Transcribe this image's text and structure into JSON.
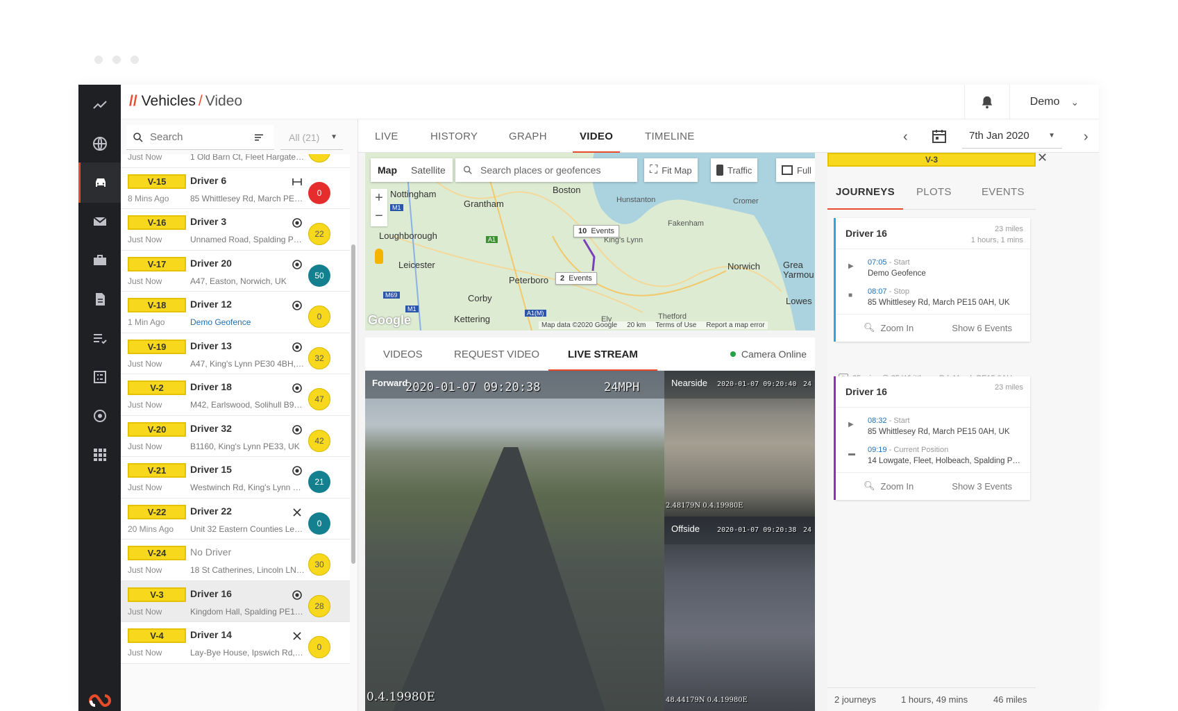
{
  "header": {
    "breadcrumb_root": "Vehicles",
    "breadcrumb_current": "Video",
    "user": "Demo"
  },
  "vehicle_list": {
    "search_placeholder": "Search",
    "filter_label": "All (21)",
    "rows": [
      {
        "tag": "",
        "driver": "",
        "time": "Just Now",
        "address": "1 Old Barn Ct, Fleet Hargate, H...",
        "status": "",
        "badge": "",
        "badge_color": "yellow"
      },
      {
        "tag": "V-15",
        "driver": "Driver 6",
        "time": "8 Mins Ago",
        "address": "85 Whittlesey Rd, March PE15 ...",
        "status": "parked",
        "badge": "0",
        "badge_color": "red"
      },
      {
        "tag": "V-16",
        "driver": "Driver 3",
        "time": "Just Now",
        "address": "Unnamed Road, Spalding PE1...",
        "status": "moving",
        "badge": "22",
        "badge_color": "yellow"
      },
      {
        "tag": "V-17",
        "driver": "Driver 20",
        "time": "Just Now",
        "address": "A47, Easton, Norwich, UK",
        "status": "moving",
        "badge": "50",
        "badge_color": "teal"
      },
      {
        "tag": "V-18",
        "driver": "Driver 12",
        "time": "1 Min Ago",
        "address": "Demo Geofence",
        "status": "moving",
        "badge": "0",
        "badge_color": "yellow",
        "link": true
      },
      {
        "tag": "V-19",
        "driver": "Driver 13",
        "time": "Just Now",
        "address": "A47, King's Lynn PE30 4BH, UK",
        "status": "moving",
        "badge": "32",
        "badge_color": "yellow"
      },
      {
        "tag": "V-2",
        "driver": "Driver 18",
        "time": "Just Now",
        "address": "M42, Earlswood, Solihull B94 5...",
        "status": "moving",
        "badge": "47",
        "badge_color": "yellow"
      },
      {
        "tag": "V-20",
        "driver": "Driver 32",
        "time": "Just Now",
        "address": "B1160, King's Lynn PE33, UK",
        "status": "moving",
        "badge": "42",
        "badge_color": "yellow"
      },
      {
        "tag": "V-21",
        "driver": "Driver 15",
        "time": "Just Now",
        "address": "Westwinch Rd, King's Lynn PE...",
        "status": "moving",
        "badge": "21",
        "badge_color": "teal"
      },
      {
        "tag": "V-22",
        "driver": "Driver 22",
        "time": "20 Mins Ago",
        "address": "Unit 32 Eastern Counties Leat...",
        "status": "off",
        "badge": "0",
        "badge_color": "teal"
      },
      {
        "tag": "V-24",
        "driver": "No Driver",
        "time": "Just Now",
        "address": "18 St Catherines, Lincoln LN5 ...",
        "status": "",
        "badge": "30",
        "badge_color": "yellow",
        "nodriver": true
      },
      {
        "tag": "V-3",
        "driver": "Driver 16",
        "time": "Just Now",
        "address": "Kingdom Hall, Spalding PE12 ...",
        "status": "moving",
        "badge": "28",
        "badge_color": "yellow",
        "selected": true
      },
      {
        "tag": "V-4",
        "driver": "Driver 14",
        "time": "Just Now",
        "address": "Lay-Bye House, Ipswich Rd, Sa...",
        "status": "off",
        "badge": "0",
        "badge_color": "yellow"
      }
    ]
  },
  "tabs": [
    "LIVE",
    "HISTORY",
    "GRAPH",
    "VIDEO",
    "TIMELINE"
  ],
  "active_tab": "VIDEO",
  "date": "7th Jan 2020",
  "map": {
    "type_map": "Map",
    "type_satellite": "Satellite",
    "search_placeholder": "Search places or geofences",
    "fit_map": "Fit Map",
    "traffic": "Traffic",
    "full": "Full",
    "cities": {
      "nottingham": "Nottingham",
      "grantham": "Grantham",
      "boston": "Boston",
      "hunstanton": "Hunstanton",
      "cromer": "Cromer",
      "fakenham": "Fakenham",
      "kings_lynn": "King's Lynn",
      "loughborough": "Loughborough",
      "leicester": "Leicester",
      "norwich": "Norwich",
      "great_yarmouth_1": "Grea",
      "great_yarmouth_2": "Yarmou",
      "peterborough": "Peterboro",
      "corby": "Corby",
      "lowestoft": "Lowes",
      "kettering": "Kettering",
      "thetford": "Thetford",
      "ely": "Ely"
    },
    "roads": {
      "m1": "M1",
      "a1": "A1",
      "m69": "M69",
      "m1b": "M1",
      "a1m": "A1(M)"
    },
    "events_1_count": "10",
    "events_1_label": "Events",
    "events_2_count": "2",
    "events_2_label": "Events",
    "footer_data": "Map data ©2020 Google",
    "footer_scale": "20 km",
    "footer_terms": "Terms of Use",
    "footer_report": "Report a map error",
    "google": "Google"
  },
  "video_tabs": [
    "VIDEOS",
    "REQUEST VIDEO",
    "LIVE STREAM"
  ],
  "active_video_tab": "LIVE STREAM",
  "camera_status": "Camera Online",
  "videos": {
    "forward": {
      "label": "Forward",
      "timestamp": "2020-01-07 09:20:38",
      "speed": "24MPH",
      "gps": "0.4.19980E"
    },
    "nearside": {
      "label": "Nearside",
      "timestamp": "2020-01-07 09:20:40",
      "speed": "24",
      "gps": "2.48179N 0.4.19980E"
    },
    "offside": {
      "label": "Offside",
      "timestamp": "2020-01-07 09:20:38",
      "speed": "24",
      "gps": "48.44179N 0.4.19980E"
    }
  },
  "right_panel": {
    "vehicle": "V-3",
    "tabs": [
      "JOURNEYS",
      "PLOTS",
      "EVENTS"
    ],
    "active_tab": "JOURNEYS",
    "journeys": [
      {
        "driver": "Driver 16",
        "miles": "23 miles",
        "duration": "1 hours, 1 mins",
        "start_time": "07:05",
        "start_label": "- Start",
        "start_addr": "Demo Geofence",
        "end_time": "08:07",
        "end_label": "- Stop",
        "end_addr": "85 Whittlesey Rd, March PE15 0AH, UK",
        "zoom": "Zoom In",
        "show": "Show 6 Events",
        "color": "#29a8e0"
      },
      {
        "driver": "Driver 16",
        "miles": "23 miles",
        "duration": "",
        "start_time": "08:32",
        "start_label": "- Start",
        "start_addr": "85 Whittlesey Rd, March PE15 0AH, UK",
        "end_time": "09:19",
        "end_label": "- Current Position",
        "end_addr": "14 Lowgate, Fleet, Holbeach, Spalding PE...",
        "zoom": "Zoom In",
        "show": "Show 3 Events",
        "color": "#9c2ab8"
      }
    ],
    "parked": "25 mins @ 85 Whittlesey Rd, March PE15 0AH, ...",
    "summary": {
      "journeys": "2 journeys",
      "duration": "1 hours, 49 mins",
      "miles": "46 miles"
    }
  },
  "colors": {
    "accent": "#e84b2b",
    "vehicle_tag": "#f7d81c",
    "nav_bg": "#1f2023",
    "online": "#25a244"
  }
}
